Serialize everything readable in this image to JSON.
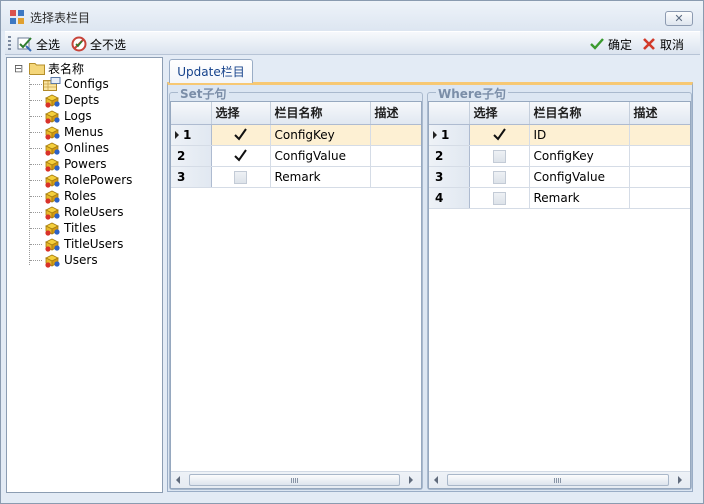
{
  "window": {
    "title": "选择表栏目",
    "close_glyph": "✕"
  },
  "toolbar": {
    "select_all_label": "全选",
    "deselect_all_label": "全不选",
    "ok_label": "确定",
    "cancel_label": "取消"
  },
  "tree": {
    "root_label": "表名称",
    "expander": "⊟",
    "items": [
      "Configs",
      "Depts",
      "Logs",
      "Menus",
      "Onlines",
      "Powers",
      "RolePowers",
      "Roles",
      "RoleUsers",
      "Titles",
      "TitleUsers",
      "Users"
    ]
  },
  "tab": {
    "label": "Update栏目"
  },
  "set_group": {
    "title": "Set子句",
    "columns": [
      "选择",
      "栏目名称",
      "描述"
    ],
    "rows": [
      {
        "num": "1",
        "checked": true,
        "name": "ConfigKey",
        "desc": "",
        "current": true
      },
      {
        "num": "2",
        "checked": true,
        "name": "ConfigValue",
        "desc": "",
        "current": false
      },
      {
        "num": "3",
        "checked": false,
        "name": "Remark",
        "desc": "",
        "current": false
      }
    ]
  },
  "where_group": {
    "title": "Where子句",
    "columns": [
      "选择",
      "栏目名称",
      "描述"
    ],
    "rows": [
      {
        "num": "1",
        "checked": true,
        "name": "ID",
        "desc": "",
        "current": true
      },
      {
        "num": "2",
        "checked": false,
        "name": "ConfigKey",
        "desc": "",
        "current": false
      },
      {
        "num": "3",
        "checked": false,
        "name": "ConfigValue",
        "desc": "",
        "current": false
      },
      {
        "num": "4",
        "checked": false,
        "name": "Remark",
        "desc": "",
        "current": false
      }
    ]
  },
  "colors": {
    "accent_tab": "#f7c873",
    "current_row": "#fdf0d3",
    "tab_text": "#15428b"
  }
}
